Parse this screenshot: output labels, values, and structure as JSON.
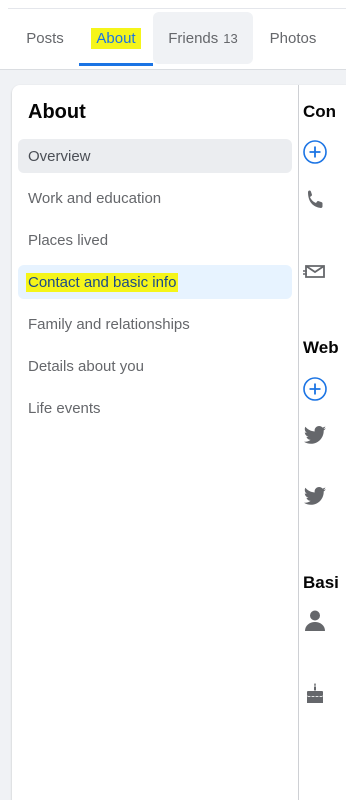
{
  "tabs": {
    "posts": "Posts",
    "about": "About",
    "friends": "Friends",
    "friends_count": "13",
    "photos": "Photos"
  },
  "about": {
    "title": "About",
    "nav": [
      "Overview",
      "Work and education",
      "Places lived",
      "Contact and basic info",
      "Family and relationships",
      "Details about you",
      "Life events"
    ]
  },
  "right_panel": {
    "contact_heading": "Con",
    "websites_heading": "Web",
    "basic_heading": "Basi"
  },
  "icons": [
    "add-circle-icon",
    "phone-icon",
    "mail-icon",
    "twitter-icon",
    "person-icon",
    "birthday-cake-icon"
  ],
  "colors": {
    "accent": "#1b74e4",
    "highlight": "#f5f51a",
    "selected_bg": "#e7f3ff",
    "icon_gray": "#65676b"
  }
}
